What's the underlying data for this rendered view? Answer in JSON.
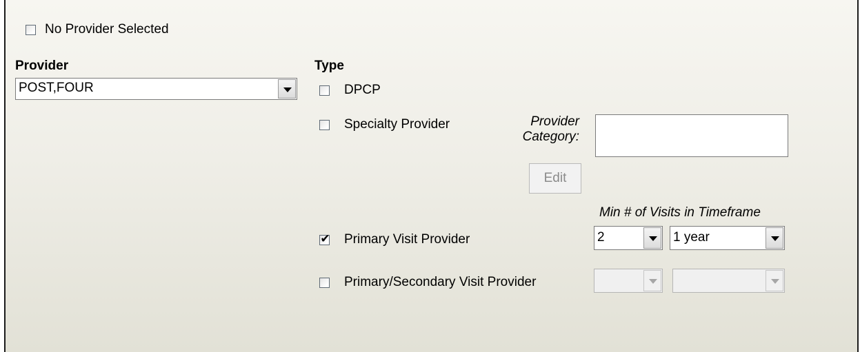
{
  "no_provider": {
    "label": "No Provider Selected",
    "checked": false
  },
  "provider": {
    "heading": "Provider",
    "selected": "POST,FOUR"
  },
  "type": {
    "heading": "Type",
    "dpcp": {
      "label": "DPCP",
      "checked": false
    },
    "specialty": {
      "label": "Specialty Provider",
      "checked": false
    },
    "category_label_line1": "Provider",
    "category_label_line2": "Category:",
    "category_value": "",
    "edit_label": "Edit",
    "min_visits_heading": "Min # of Visits in Timeframe",
    "primary_visit": {
      "label": "Primary Visit Provider",
      "checked": true,
      "check_glyph": "✔",
      "visits": "2",
      "timeframe": "1 year"
    },
    "primary_secondary": {
      "label": "Primary/Secondary Visit Provider",
      "checked": false,
      "visits": "",
      "timeframe": ""
    }
  }
}
